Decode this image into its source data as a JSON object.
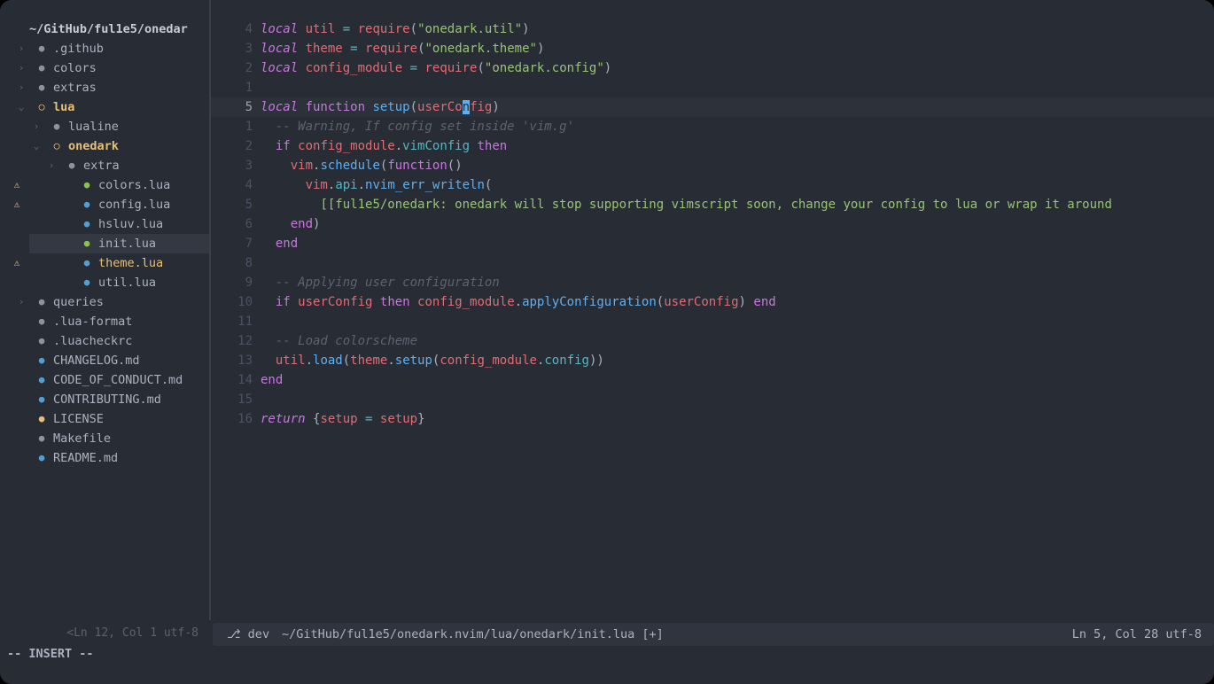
{
  "window": {
    "background": "#282c34",
    "page_background": "#000000"
  },
  "sidebar": {
    "root_label": "~/GitHub/ful1e5/onedar",
    "items": [
      {
        "label": ".github",
        "indent": 0,
        "chevron": "›",
        "icon": "folder-closed-icon",
        "icon_color": "#8b93a1",
        "text_color": "#abb2bf",
        "bold": false,
        "diagnostic": "",
        "selected": false
      },
      {
        "label": "colors",
        "indent": 0,
        "chevron": "›",
        "icon": "folder-closed-icon",
        "icon_color": "#8b93a1",
        "text_color": "#abb2bf",
        "bold": false,
        "diagnostic": "",
        "selected": false
      },
      {
        "label": "extras",
        "indent": 0,
        "chevron": "›",
        "icon": "folder-closed-icon",
        "icon_color": "#8b93a1",
        "text_color": "#abb2bf",
        "bold": false,
        "diagnostic": "",
        "selected": false
      },
      {
        "label": "lua",
        "indent": 0,
        "chevron": "⌄",
        "icon": "folder-open-icon",
        "icon_color": "#e5c07b",
        "text_color": "#e5c07b",
        "bold": true,
        "diagnostic": "",
        "selected": false
      },
      {
        "label": "lualine",
        "indent": 1,
        "chevron": "›",
        "icon": "folder-closed-icon",
        "icon_color": "#8b93a1",
        "text_color": "#abb2bf",
        "bold": false,
        "diagnostic": "",
        "selected": false
      },
      {
        "label": "onedark",
        "indent": 1,
        "chevron": "⌄",
        "icon": "folder-open-icon",
        "icon_color": "#e5c07b",
        "text_color": "#e5c07b",
        "bold": true,
        "diagnostic": "",
        "selected": false
      },
      {
        "label": "extra",
        "indent": 2,
        "chevron": "›",
        "icon": "folder-closed-icon",
        "icon_color": "#8b93a1",
        "text_color": "#abb2bf",
        "bold": false,
        "diagnostic": "",
        "selected": false
      },
      {
        "label": "colors.lua",
        "indent": 3,
        "chevron": "",
        "icon": "lua-file-icon",
        "icon_color": "#8bc34a",
        "text_color": "#abb2bf",
        "bold": false,
        "diagnostic": "⚠",
        "selected": false
      },
      {
        "label": "config.lua",
        "indent": 3,
        "chevron": "",
        "icon": "lua-file-icon",
        "icon_color": "#51a0cf",
        "text_color": "#abb2bf",
        "bold": false,
        "diagnostic": "⚠",
        "selected": false
      },
      {
        "label": "hsluv.lua",
        "indent": 3,
        "chevron": "",
        "icon": "lua-file-icon",
        "icon_color": "#51a0cf",
        "text_color": "#abb2bf",
        "bold": false,
        "diagnostic": "",
        "selected": false
      },
      {
        "label": "init.lua",
        "indent": 3,
        "chevron": "",
        "icon": "lua-file-icon",
        "icon_color": "#8bc34a",
        "text_color": "#abb2bf",
        "bold": false,
        "diagnostic": "",
        "selected": true
      },
      {
        "label": "theme.lua",
        "indent": 3,
        "chevron": "",
        "icon": "lua-file-icon",
        "icon_color": "#51a0cf",
        "text_color": "#e5c07b",
        "bold": false,
        "diagnostic": "⚠",
        "selected": false
      },
      {
        "label": "util.lua",
        "indent": 3,
        "chevron": "",
        "icon": "lua-file-icon",
        "icon_color": "#51a0cf",
        "text_color": "#abb2bf",
        "bold": false,
        "diagnostic": "",
        "selected": false
      },
      {
        "label": "queries",
        "indent": 0,
        "chevron": "›",
        "icon": "folder-closed-icon",
        "icon_color": "#8b93a1",
        "text_color": "#abb2bf",
        "bold": false,
        "diagnostic": "",
        "selected": false
      },
      {
        "label": ".lua-format",
        "indent": 0,
        "chevron": "",
        "icon": "file-icon",
        "icon_color": "#8b93a1",
        "text_color": "#abb2bf",
        "bold": false,
        "diagnostic": "",
        "selected": false
      },
      {
        "label": ".luacheckrc",
        "indent": 0,
        "chevron": "",
        "icon": "file-icon",
        "icon_color": "#8b93a1",
        "text_color": "#abb2bf",
        "bold": false,
        "diagnostic": "",
        "selected": false
      },
      {
        "label": "CHANGELOG.md",
        "indent": 0,
        "chevron": "",
        "icon": "markdown-file-icon",
        "icon_color": "#51a0cf",
        "text_color": "#abb2bf",
        "bold": false,
        "diagnostic": "",
        "selected": false
      },
      {
        "label": "CODE_OF_CONDUCT.md",
        "indent": 0,
        "chevron": "",
        "icon": "markdown-file-icon",
        "icon_color": "#51a0cf",
        "text_color": "#abb2bf",
        "bold": false,
        "diagnostic": "",
        "selected": false
      },
      {
        "label": "CONTRIBUTING.md",
        "indent": 0,
        "chevron": "",
        "icon": "markdown-file-icon",
        "icon_color": "#51a0cf",
        "text_color": "#abb2bf",
        "bold": false,
        "diagnostic": "",
        "selected": false
      },
      {
        "label": "LICENSE",
        "indent": 0,
        "chevron": "",
        "icon": "license-file-icon",
        "icon_color": "#e5c07b",
        "text_color": "#abb2bf",
        "bold": false,
        "diagnostic": "",
        "selected": false
      },
      {
        "label": "Makefile",
        "indent": 0,
        "chevron": "",
        "icon": "file-icon",
        "icon_color": "#8b93a1",
        "text_color": "#abb2bf",
        "bold": false,
        "diagnostic": "",
        "selected": false
      },
      {
        "label": "README.md",
        "indent": 0,
        "chevron": "",
        "icon": "markdown-file-icon",
        "icon_color": "#51a0cf",
        "text_color": "#abb2bf",
        "bold": false,
        "diagnostic": "",
        "selected": false
      }
    ]
  },
  "editor": {
    "cursor_line_index": 4,
    "lines": [
      {
        "num": "4",
        "current": false,
        "tokens": [
          {
            "t": "local ",
            "c": "kw"
          },
          {
            "t": "util",
            "c": "var"
          },
          {
            "t": " ",
            "c": "pun"
          },
          {
            "t": "=",
            "c": "op"
          },
          {
            "t": " ",
            "c": "pun"
          },
          {
            "t": "require",
            "c": "var"
          },
          {
            "t": "(",
            "c": "pun"
          },
          {
            "t": "\"onedark.util\"",
            "c": "str"
          },
          {
            "t": ")",
            "c": "pun"
          }
        ]
      },
      {
        "num": "3",
        "current": false,
        "tokens": [
          {
            "t": "local ",
            "c": "kw"
          },
          {
            "t": "theme",
            "c": "var"
          },
          {
            "t": " ",
            "c": "pun"
          },
          {
            "t": "=",
            "c": "op"
          },
          {
            "t": " ",
            "c": "pun"
          },
          {
            "t": "require",
            "c": "var"
          },
          {
            "t": "(",
            "c": "pun"
          },
          {
            "t": "\"onedark.theme\"",
            "c": "str"
          },
          {
            "t": ")",
            "c": "pun"
          }
        ]
      },
      {
        "num": "2",
        "current": false,
        "tokens": [
          {
            "t": "local ",
            "c": "kw"
          },
          {
            "t": "config_module",
            "c": "var"
          },
          {
            "t": " ",
            "c": "pun"
          },
          {
            "t": "=",
            "c": "op"
          },
          {
            "t": " ",
            "c": "pun"
          },
          {
            "t": "require",
            "c": "var"
          },
          {
            "t": "(",
            "c": "pun"
          },
          {
            "t": "\"onedark.config\"",
            "c": "str"
          },
          {
            "t": ")",
            "c": "pun"
          }
        ]
      },
      {
        "num": "1",
        "current": false,
        "tokens": []
      },
      {
        "num": "5",
        "current": true,
        "tokens": [
          {
            "t": "local ",
            "c": "kw"
          },
          {
            "t": "function",
            "c": "kw2"
          },
          {
            "t": " ",
            "c": "pun"
          },
          {
            "t": "setup",
            "c": "fn"
          },
          {
            "t": "(",
            "c": "pun"
          },
          {
            "t": "userCo",
            "c": "var"
          },
          {
            "t": "n",
            "c": "cursor"
          },
          {
            "t": "fig",
            "c": "var"
          },
          {
            "t": ")",
            "c": "pun"
          }
        ]
      },
      {
        "num": "1",
        "current": false,
        "tokens": [
          {
            "t": "  -- Warning, If config set inside 'vim.g'",
            "c": "com"
          }
        ]
      },
      {
        "num": "2",
        "current": false,
        "tokens": [
          {
            "t": "  ",
            "c": "pun"
          },
          {
            "t": "if",
            "c": "kw2"
          },
          {
            "t": " ",
            "c": "pun"
          },
          {
            "t": "config_module",
            "c": "var"
          },
          {
            "t": ".",
            "c": "pun"
          },
          {
            "t": "vimConfig",
            "c": "op"
          },
          {
            "t": " ",
            "c": "pun"
          },
          {
            "t": "then",
            "c": "kw2"
          }
        ]
      },
      {
        "num": "3",
        "current": false,
        "tokens": [
          {
            "t": "    ",
            "c": "pun"
          },
          {
            "t": "vim",
            "c": "var"
          },
          {
            "t": ".",
            "c": "pun"
          },
          {
            "t": "schedule",
            "c": "fn"
          },
          {
            "t": "(",
            "c": "pun"
          },
          {
            "t": "function",
            "c": "kw2"
          },
          {
            "t": "()",
            "c": "pun"
          }
        ]
      },
      {
        "num": "4",
        "current": false,
        "tokens": [
          {
            "t": "      ",
            "c": "pun"
          },
          {
            "t": "vim",
            "c": "var"
          },
          {
            "t": ".",
            "c": "pun"
          },
          {
            "t": "api",
            "c": "op"
          },
          {
            "t": ".",
            "c": "pun"
          },
          {
            "t": "nvim_err_writeln",
            "c": "fn"
          },
          {
            "t": "(",
            "c": "pun"
          }
        ]
      },
      {
        "num": "5",
        "current": false,
        "tokens": [
          {
            "t": "        ",
            "c": "pun"
          },
          {
            "t": "[[ful1e5/onedark: onedark will stop supporting vimscript soon, change your config to lua or wrap it around",
            "c": "str"
          }
        ]
      },
      {
        "num": "6",
        "current": false,
        "tokens": [
          {
            "t": "    ",
            "c": "pun"
          },
          {
            "t": "end",
            "c": "kw2"
          },
          {
            "t": ")",
            "c": "pun"
          }
        ]
      },
      {
        "num": "7",
        "current": false,
        "tokens": [
          {
            "t": "  ",
            "c": "pun"
          },
          {
            "t": "end",
            "c": "kw2"
          }
        ]
      },
      {
        "num": "8",
        "current": false,
        "tokens": []
      },
      {
        "num": "9",
        "current": false,
        "tokens": [
          {
            "t": "  -- Applying user configuration",
            "c": "com"
          }
        ]
      },
      {
        "num": "10",
        "current": false,
        "tokens": [
          {
            "t": "  ",
            "c": "pun"
          },
          {
            "t": "if",
            "c": "kw2"
          },
          {
            "t": " ",
            "c": "pun"
          },
          {
            "t": "userConfig",
            "c": "var"
          },
          {
            "t": " ",
            "c": "pun"
          },
          {
            "t": "then",
            "c": "kw2"
          },
          {
            "t": " ",
            "c": "pun"
          },
          {
            "t": "config_module",
            "c": "var"
          },
          {
            "t": ".",
            "c": "pun"
          },
          {
            "t": "applyConfiguration",
            "c": "fn"
          },
          {
            "t": "(",
            "c": "pun"
          },
          {
            "t": "userConfig",
            "c": "var"
          },
          {
            "t": ")",
            "c": "pun"
          },
          {
            "t": " ",
            "c": "pun"
          },
          {
            "t": "end",
            "c": "kw2"
          }
        ]
      },
      {
        "num": "11",
        "current": false,
        "tokens": []
      },
      {
        "num": "12",
        "current": false,
        "tokens": [
          {
            "t": "  -- Load colorscheme",
            "c": "com"
          }
        ]
      },
      {
        "num": "13",
        "current": false,
        "tokens": [
          {
            "t": "  ",
            "c": "pun"
          },
          {
            "t": "util",
            "c": "var"
          },
          {
            "t": ".",
            "c": "pun"
          },
          {
            "t": "load",
            "c": "fn"
          },
          {
            "t": "(",
            "c": "pun"
          },
          {
            "t": "theme",
            "c": "var"
          },
          {
            "t": ".",
            "c": "pun"
          },
          {
            "t": "setup",
            "c": "fn"
          },
          {
            "t": "(",
            "c": "pun"
          },
          {
            "t": "config_module",
            "c": "var"
          },
          {
            "t": ".",
            "c": "pun"
          },
          {
            "t": "config",
            "c": "op"
          },
          {
            "t": "))",
            "c": "pun"
          }
        ]
      },
      {
        "num": "14",
        "current": false,
        "tokens": [
          {
            "t": "end",
            "c": "kw2"
          }
        ]
      },
      {
        "num": "15",
        "current": false,
        "tokens": []
      },
      {
        "num": "16",
        "current": false,
        "tokens": [
          {
            "t": "return",
            "c": "kw"
          },
          {
            "t": " ",
            "c": "pun"
          },
          {
            "t": "{",
            "c": "pun"
          },
          {
            "t": "setup",
            "c": "var"
          },
          {
            "t": " ",
            "c": "pun"
          },
          {
            "t": "=",
            "c": "op"
          },
          {
            "t": " ",
            "c": "pun"
          },
          {
            "t": "setup",
            "c": "var"
          },
          {
            "t": "}",
            "c": "pun"
          }
        ]
      }
    ]
  },
  "statusline": {
    "inactive_left": "<Ln 12, Col 1  utf-8",
    "branch_icon": "git-branch-icon",
    "branch": "dev",
    "file_path": "~/GitHub/ful1e5/onedark.nvim/lua/onedark/init.lua [+]",
    "right": "Ln 5, Col 28  utf-8",
    "mode": "-- INSERT --"
  }
}
